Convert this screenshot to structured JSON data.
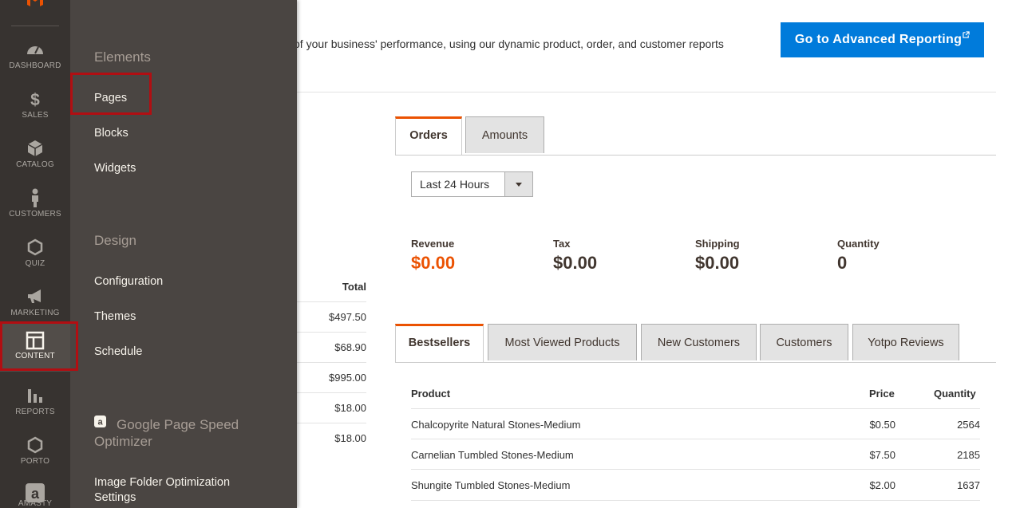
{
  "nav": {
    "items": [
      {
        "label": "Dashboard",
        "icon": "dashboard-icon"
      },
      {
        "label": "Sales",
        "icon": "dollar-icon"
      },
      {
        "label": "Catalog",
        "icon": "box-icon"
      },
      {
        "label": "Customers",
        "icon": "person-icon"
      },
      {
        "label": "Quiz",
        "icon": "hexagon-icon"
      },
      {
        "label": "Marketing",
        "icon": "megaphone-icon"
      },
      {
        "label": "Content",
        "icon": "layout-icon"
      },
      {
        "label": "Reports",
        "icon": "bar-chart-icon"
      },
      {
        "label": "Porto",
        "icon": "hexagon-icon"
      },
      {
        "label": "Amasty",
        "icon": "amasty-logo-icon"
      }
    ],
    "active": "Content"
  },
  "submenu": {
    "elements_title": "Elements",
    "elements": [
      "Pages",
      "Blocks",
      "Widgets"
    ],
    "design_title": "Design",
    "design": [
      "Configuration",
      "Themes",
      "Schedule"
    ],
    "gpso_title": "Google Page Speed Optimizer",
    "image_folder_link": "Image Folder Optimization Settings"
  },
  "header": {
    "description": "of your business' performance, using our dynamic product, order, and customer reports",
    "advanced_button": "Go to Advanced Reporting"
  },
  "left_table": {
    "total_header": "Total",
    "totals": [
      "$497.50",
      "$68.90",
      "$995.00",
      "$18.00",
      "$18.00"
    ]
  },
  "chart_tabs": [
    "Orders",
    "Amounts"
  ],
  "period_select": {
    "value": "Last 24 Hours"
  },
  "metrics": [
    {
      "label": "Revenue",
      "value": "$0.00"
    },
    {
      "label": "Tax",
      "value": "$0.00"
    },
    {
      "label": "Shipping",
      "value": "$0.00"
    },
    {
      "label": "Quantity",
      "value": "0"
    }
  ],
  "grid_tabs": [
    "Bestsellers",
    "Most Viewed Products",
    "New Customers",
    "Customers",
    "Yotpo Reviews"
  ],
  "bestsellers": {
    "columns": [
      "Product",
      "Price",
      "Quantity"
    ],
    "rows": [
      {
        "product": "Chalcopyrite Natural Stones-Medium",
        "price": "$0.50",
        "quantity": "2564"
      },
      {
        "product": "Carnelian Tumbled Stones-Medium",
        "price": "$7.50",
        "quantity": "2185"
      },
      {
        "product": "Shungite Tumbled Stones-Medium",
        "price": "$2.00",
        "quantity": "1637"
      }
    ]
  },
  "colors": {
    "accent": "#eb5202",
    "button": "#007bdb",
    "nav_bg": "#373330",
    "submenu_bg": "#4a4542",
    "highlight": "#b10e12"
  }
}
